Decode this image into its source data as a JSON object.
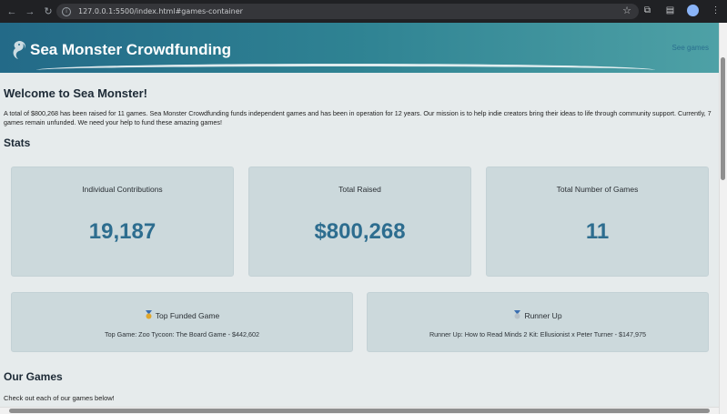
{
  "browser": {
    "url": "127.0.0.1:5500/index.html#games-container"
  },
  "header": {
    "title": "Sea Monster Crowdfunding",
    "nav_link": "See games"
  },
  "welcome": {
    "heading": "Welcome to Sea Monster!",
    "text": "A total of $800,268 has been raised for 11 games. Sea Monster Crowdfunding funds independent games and has been in operation for 12 years. Our mission is to help indie creators bring their ideas to life through community support. Currently, 7 games remain unfunded. We need your help to fund these amazing games!"
  },
  "stats": {
    "heading": "Stats",
    "cards": [
      {
        "title": "Individual Contributions",
        "value": "19,187"
      },
      {
        "title": "Total Raised",
        "value": "$800,268"
      },
      {
        "title": "Total Number of Games",
        "value": "11"
      }
    ],
    "top_funded": {
      "title": "Top Funded Game",
      "text": "Top Game: Zoo Tycoon: The Board Game - $442,602"
    },
    "runner_up": {
      "title": "Runner Up",
      "text": "Runner Up: How to Read Minds 2 Kit: Ellusionist x Peter Turner - $147,975"
    }
  },
  "games": {
    "heading": "Our Games",
    "text": "Check out each of our games below!"
  },
  "colors": {
    "accent": "#2d6d8f",
    "card_bg": "#ccd9dc",
    "page_bg": "#e6ebec"
  }
}
